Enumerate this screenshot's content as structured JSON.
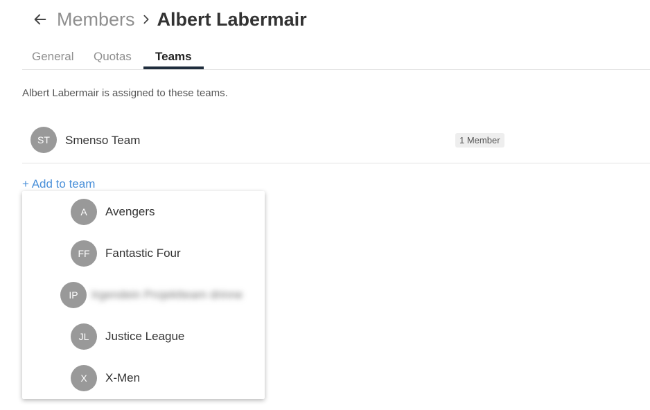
{
  "header": {
    "back_icon": "arrow-left-icon",
    "parent": "Members",
    "separator_icon": "chevron-right-icon",
    "current": "Albert Labermair"
  },
  "tabs": [
    {
      "label": "General",
      "active": false
    },
    {
      "label": "Quotas",
      "active": false
    },
    {
      "label": "Teams",
      "active": true
    }
  ],
  "intro_text": "Albert Labermair is assigned to these teams.",
  "assigned_teams": [
    {
      "initials": "ST",
      "name": "Smenso Team",
      "badge": "1 Member"
    }
  ],
  "add_to_team_label": "+ Add to team",
  "dropdown": {
    "items": [
      {
        "initials": "A",
        "name": "Avengers"
      },
      {
        "initials": "FF",
        "name": "Fantastic Four"
      },
      {
        "initials": "IP",
        "name": "Irgendein Projektteam drinne"
      },
      {
        "initials": "JL",
        "name": "Justice League"
      },
      {
        "initials": "X",
        "name": "X-Men"
      }
    ]
  },
  "colors": {
    "avatar_bg": "#999999",
    "link": "#4a90d9",
    "tab_underline": "#1f2d3d"
  }
}
